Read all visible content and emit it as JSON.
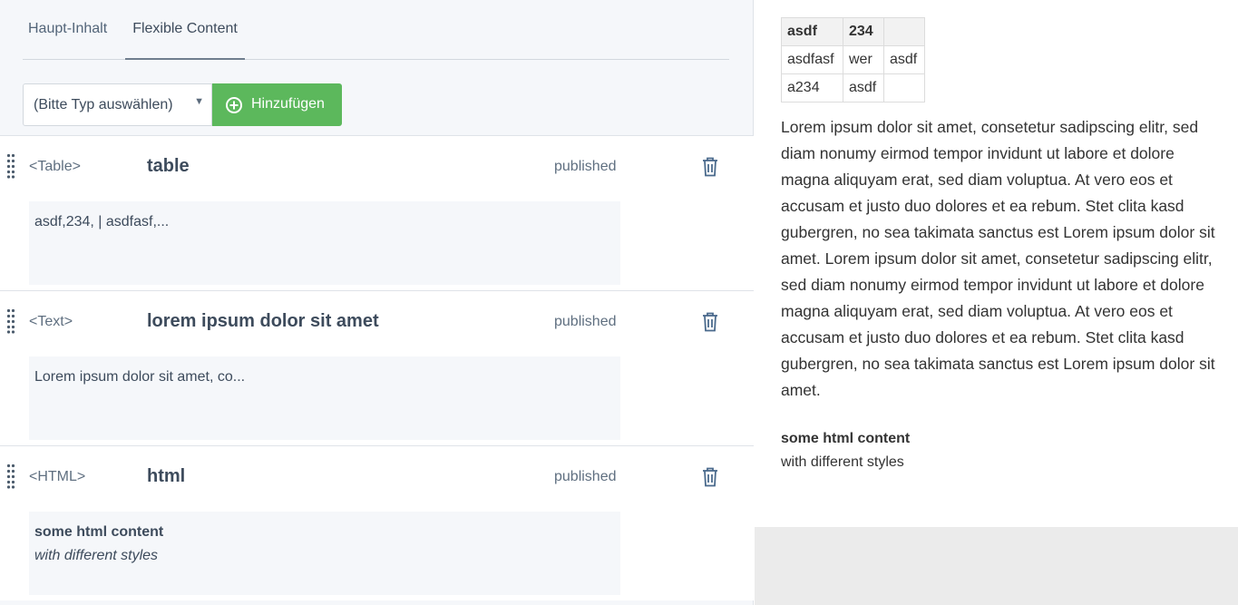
{
  "tabs": [
    "Haupt-Inhalt",
    "Flexible Content"
  ],
  "active_tab": "Flexible Content",
  "toolbar": {
    "select_value": "(Bitte Typ auswählen)",
    "add_label": "Hinzufügen"
  },
  "blocks": [
    {
      "type": "<Table>",
      "title": "table",
      "status": "published",
      "preview": "asdf,234, | asdfasf,..."
    },
    {
      "type": "<Text>",
      "title": "lorem ipsum dolor sit amet",
      "status": "published",
      "preview": "Lorem ipsum dolor sit amet, co..."
    },
    {
      "type": "<HTML>",
      "title": "html",
      "status": "published",
      "preview_bold": "some html content",
      "preview_italic": "with different styles"
    }
  ],
  "render": {
    "table": [
      [
        "asdf",
        "234",
        ""
      ],
      [
        "asdfasf",
        "wer",
        "asdf"
      ],
      [
        "a234",
        "asdf",
        ""
      ]
    ],
    "lorem": "Lorem ipsum dolor sit amet, consetetur sadipscing elitr, sed diam nonumy eirmod tempor invidunt ut labore et dolore magna aliquyam erat, sed diam voluptua. At vero eos et accusam et justo duo dolores et ea rebum. Stet clita kasd gubergren, no sea takimata sanctus est Lorem ipsum dolor sit amet. Lorem ipsum dolor sit amet, consetetur sadipscing elitr, sed diam nonumy eirmod tempor invidunt ut labore et dolore magna aliquyam erat, sed diam voluptua. At vero eos et accusam et justo duo dolores et ea rebum. Stet clita kasd gubergren, no sea takimata sanctus est Lorem ipsum dolor sit amet.",
    "html_bold": "some html content",
    "html_plain": "with different styles"
  },
  "colors": {
    "add_button": "#5cb85c",
    "text": "#3d4b5c",
    "panel_bg": "#f5f7fa"
  },
  "icons": {
    "add": "plus-circle-icon",
    "delete": "trash-icon",
    "drag": "drag-handle-icon",
    "select": "caret-down-icon"
  }
}
